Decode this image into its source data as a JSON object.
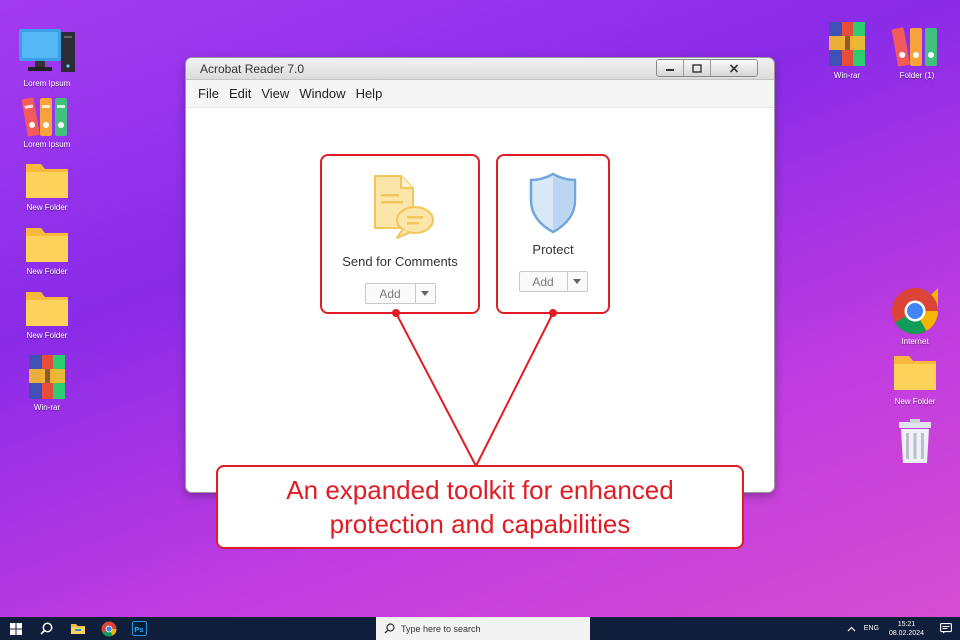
{
  "desktop": {
    "left_icons": [
      {
        "label": "Lorem Ipsum",
        "icon": "computer-icon"
      },
      {
        "label": "Lorem Ipsum",
        "icon": "binders-icon"
      },
      {
        "label": "New Folder",
        "icon": "folder-icon"
      },
      {
        "label": "New Folder",
        "icon": "folder-icon"
      },
      {
        "label": "New Folder",
        "icon": "folder-icon"
      },
      {
        "label": "Win-rar",
        "icon": "winrar-icon"
      }
    ],
    "right_icons": [
      {
        "label": "Win-rar",
        "icon": "winrar-icon"
      },
      {
        "label": "Folder (1)",
        "icon": "binders-icon"
      },
      {
        "label": "Internet",
        "icon": "chrome-icon"
      },
      {
        "label": "New Folder",
        "icon": "folder-icon"
      },
      {
        "label": "",
        "icon": "recycle-bin-icon"
      }
    ]
  },
  "window": {
    "title": "Acrobat Reader 7.0",
    "menu": [
      "File",
      "Edit",
      "View",
      "Window",
      "Help"
    ],
    "tools": [
      {
        "label": "Send for Comments",
        "button": "Add",
        "icon": "send-for-comments-icon"
      },
      {
        "label": "Protect",
        "button": "Add",
        "icon": "shield-icon"
      }
    ]
  },
  "callout": {
    "text": "An expanded toolkit for enhanced protection and capabilities"
  },
  "taskbar": {
    "search_placeholder": "Type here to search",
    "language": "ENG",
    "time": "15:21",
    "date": "08.02.2024"
  },
  "colors": {
    "accent_red": "#e01c24",
    "desktop_purple": "#9b36ec",
    "taskbar": "#0f1e3a"
  }
}
